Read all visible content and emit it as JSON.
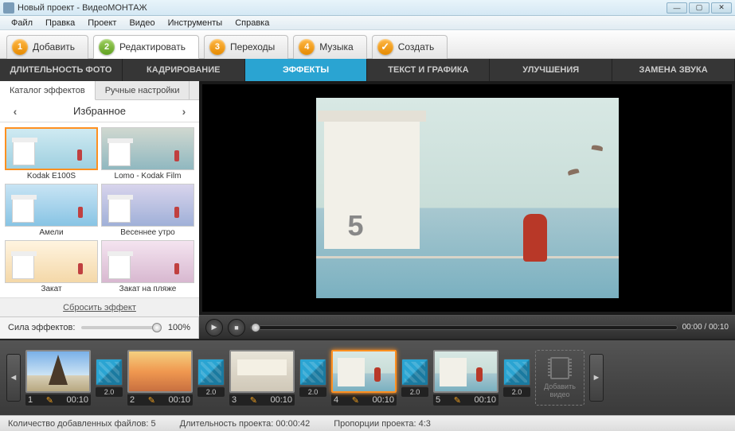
{
  "titlebar": {
    "title": "Новый проект - ВидеоМОНТАЖ"
  },
  "menu": {
    "file": "Файл",
    "edit": "Правка",
    "project": "Проект",
    "video": "Видео",
    "tools": "Инструменты",
    "help": "Справка"
  },
  "steps": {
    "add": "Добавить",
    "edit": "Редактировать",
    "transitions": "Переходы",
    "music": "Музыка",
    "create": "Создать",
    "active_index": 1
  },
  "sections": {
    "duration": "ДЛИТЕЛЬНОСТЬ ФОТО",
    "crop": "КАДРИРОВАНИЕ",
    "effects": "ЭФФЕКТЫ",
    "text": "ТЕКСТ И ГРАФИКА",
    "improve": "УЛУЧШЕНИЯ",
    "audio": "ЗАМЕНА ЗВУКА",
    "active": "effects"
  },
  "effects_panel": {
    "tab_catalog": "Каталог эффектов",
    "tab_manual": "Ручные настройки",
    "category": "Избранное",
    "items": [
      {
        "label": "Kodak E100S",
        "tint": "linear-gradient(#cfeaf2,#9fd0e0)",
        "selected": true
      },
      {
        "label": "Lomo - Kodak Film",
        "tint": "linear-gradient(#d0d8d0,#90b8c0)"
      },
      {
        "label": "Амели",
        "tint": "linear-gradient(#c8e4f4,#88c4e4)"
      },
      {
        "label": "Весеннее утро",
        "tint": "linear-gradient(#d8d4ec,#a0b0d8)"
      },
      {
        "label": "Закат",
        "tint": "linear-gradient(#fff4e0,#f4d8a8)"
      },
      {
        "label": "Закат на пляже",
        "tint": "linear-gradient(#f4e4f0,#d8b8d0)"
      }
    ],
    "reset_label": "Сбросить эффект"
  },
  "strength": {
    "label": "Сила эффектов:",
    "value": "100%"
  },
  "player": {
    "time": "00:00 / 00:10"
  },
  "timeline": {
    "transition_duration": "2.0",
    "clips": [
      {
        "index": "1",
        "duration": "00:10",
        "scene": "scene-eiffel",
        "selected": false
      },
      {
        "index": "2",
        "duration": "00:10",
        "scene": "scene-sunset",
        "selected": false
      },
      {
        "index": "3",
        "duration": "00:10",
        "scene": "scene-interior",
        "selected": false
      },
      {
        "index": "4",
        "duration": "00:10",
        "scene": "scene-beach",
        "selected": true
      },
      {
        "index": "5",
        "duration": "00:10",
        "scene": "scene-beach",
        "selected": false
      }
    ],
    "add_label": "Добавить видео"
  },
  "status": {
    "files_label": "Количество добавленных файлов:",
    "files_value": "5",
    "duration_label": "Длительность проекта:",
    "duration_value": "00:00:42",
    "aspect_label": "Пропорции проекта:",
    "aspect_value": "4:3"
  }
}
